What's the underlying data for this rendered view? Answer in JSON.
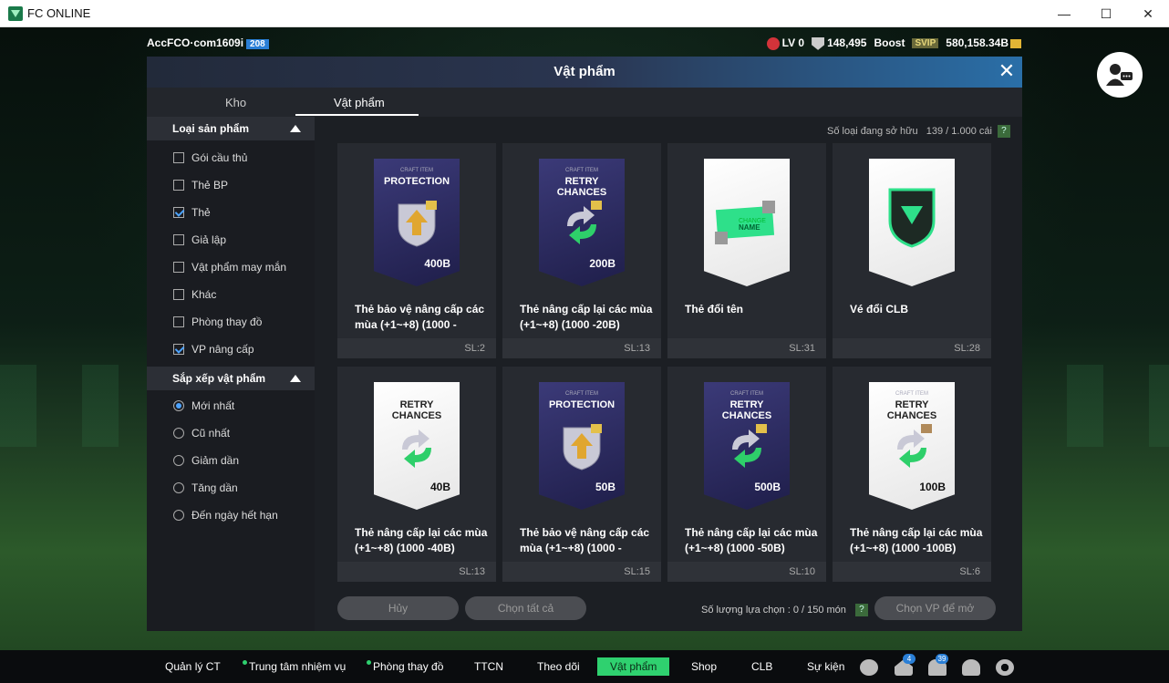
{
  "window": {
    "title": "FC ONLINE",
    "min": "—",
    "max": "☐",
    "close": "✕"
  },
  "topbar": {
    "account": "AccFCO·com1609i",
    "account_level": "208",
    "level": "LV 0",
    "currency1": "148,495",
    "boost": "Boost",
    "svip": "SVIP",
    "currency2": "580,158.34B"
  },
  "modal": {
    "title": "Vật phẩm",
    "close": "✕",
    "tabs": [
      {
        "label": "Kho"
      },
      {
        "label": "Vật phẩm"
      }
    ],
    "owned_label": "Số loại đang sở hữu",
    "owned_value": "139 / 1.000 cái",
    "help": "?",
    "sections": {
      "type_title": "Loại sản phẩm",
      "sort_title": "Sắp xếp vật phẩm"
    },
    "type_filters": [
      {
        "label": "Gói cầu thủ",
        "checked": false
      },
      {
        "label": "Thẻ BP",
        "checked": false
      },
      {
        "label": "Thẻ",
        "checked": true
      },
      {
        "label": "Giả lập",
        "checked": false
      },
      {
        "label": "Vật phẩm may mắn",
        "checked": false
      },
      {
        "label": "Khác",
        "checked": false
      },
      {
        "label": "Phòng thay đồ",
        "checked": false
      },
      {
        "label": "VP nâng cấp",
        "checked": true
      }
    ],
    "sort_options": [
      {
        "label": "Mới nhất",
        "selected": true
      },
      {
        "label": "Cũ nhất",
        "selected": false
      },
      {
        "label": "Giảm dần",
        "selected": false
      },
      {
        "label": "Tăng dần",
        "selected": false
      },
      {
        "label": "Đến ngày hết hạn",
        "selected": false
      }
    ],
    "items": [
      {
        "name": "Thẻ bảo vệ nâng cấp các mùa (+1~+8) (1000 -",
        "sl": "SL:2",
        "tag": "CRAFT ITEM",
        "title": "PROTECTION",
        "amount": "400B",
        "style": "dark",
        "icon": "shield-icon"
      },
      {
        "name": "Thẻ nâng cấp lại các mùa (+1~+8) (1000 -20B)",
        "sl": "SL:13",
        "tag": "CRAFT ITEM",
        "title": "RETRY CHANCES",
        "amount": "200B",
        "style": "dark",
        "icon": "retry-icon"
      },
      {
        "name": "Thẻ đổi tên",
        "sl": "SL:31",
        "tag": "",
        "title": "",
        "amount": "",
        "style": "white",
        "icon": "change-name-icon"
      },
      {
        "name": "Vé đổi CLB",
        "sl": "SL:28",
        "tag": "",
        "title": "",
        "amount": "",
        "style": "white",
        "icon": "club-icon"
      },
      {
        "name": "Thẻ nâng cấp lại các mùa (+1~+8) (1000 -40B)",
        "sl": "SL:13",
        "tag": "",
        "title": "RETRY CHANCES",
        "amount": "40B",
        "style": "white",
        "icon": "retry-icon"
      },
      {
        "name": "Thẻ bảo vệ nâng cấp các mùa (+1~+8) (1000 -",
        "sl": "SL:15",
        "tag": "CRAFT ITEM",
        "title": "PROTECTION",
        "amount": "50B",
        "style": "dark",
        "icon": "shield-icon"
      },
      {
        "name": "Thẻ nâng cấp lại các mùa (+1~+8) (1000 -50B)",
        "sl": "SL:10",
        "tag": "CRAFT ITEM",
        "title": "RETRY CHANCES",
        "amount": "500B",
        "style": "dark",
        "icon": "retry-icon"
      },
      {
        "name": "Thẻ nâng cấp lại các mùa (+1~+8) (1000 -100B)",
        "sl": "SL:6",
        "tag": "CRAFT ITEM",
        "title": "RETRY CHANCES",
        "amount": "100B",
        "style": "white",
        "icon": "retry-icon"
      }
    ],
    "buttons": {
      "cancel": "Hủy",
      "select_all": "Chọn tất cả",
      "select_count_label": "Số lượng lựa chọn : 0 / 150 món",
      "choose": "Chọn VP để mở"
    }
  },
  "bottom_nav": {
    "items": [
      {
        "label": "Quản lý CT"
      },
      {
        "label": "Trung tâm nhiệm vụ"
      },
      {
        "label": "Phòng thay đồ"
      },
      {
        "label": "TTCN"
      },
      {
        "label": "Theo dõi"
      },
      {
        "label": "Vật phẩm"
      },
      {
        "label": "Shop"
      },
      {
        "label": "CLB"
      },
      {
        "label": "Sự kiện"
      }
    ],
    "badges": {
      "home": "4",
      "bell": "39"
    }
  }
}
